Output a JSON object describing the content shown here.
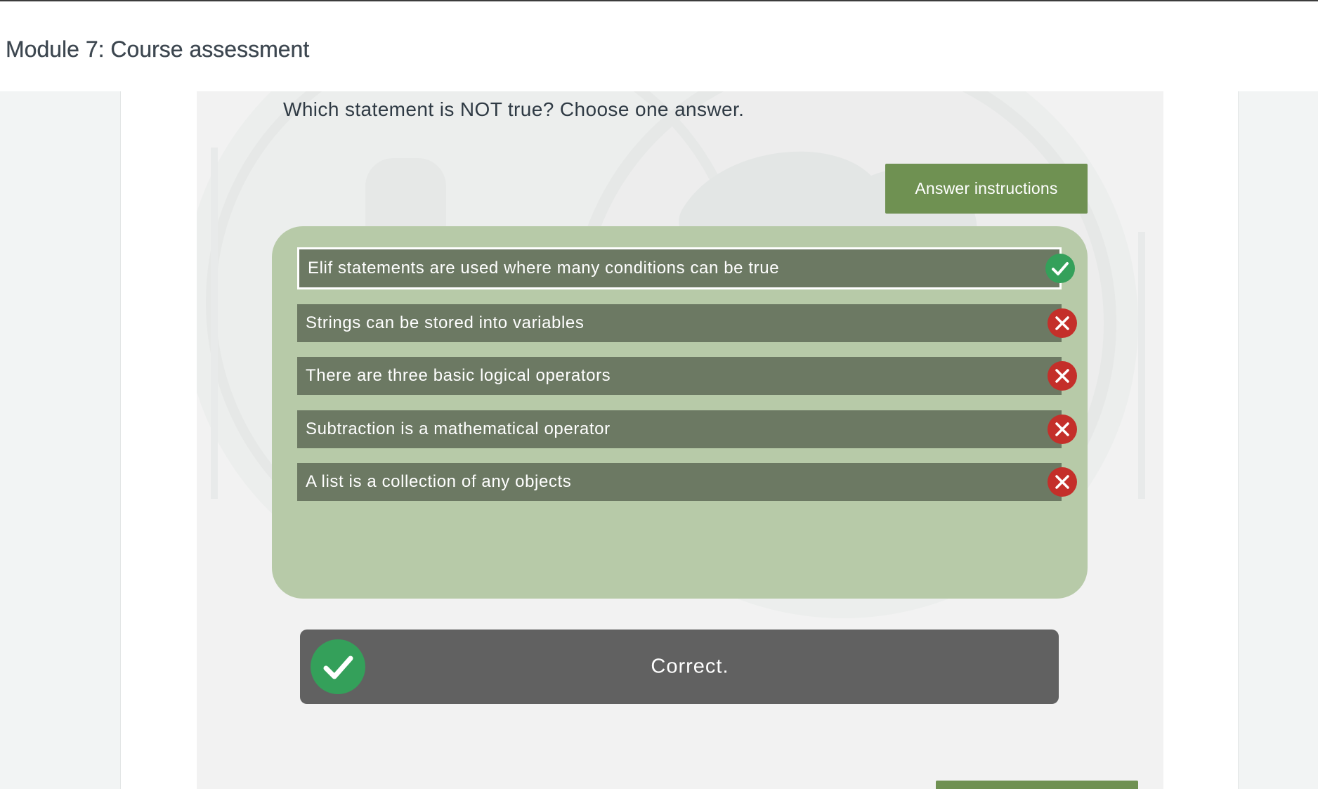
{
  "header": {
    "title": "Module 7: Course assessment"
  },
  "activity": {
    "question": "Which statement is NOT true? Choose one answer.",
    "answer_instructions_label": "Answer instructions",
    "answers": [
      {
        "text": "Elif statements are used where many conditions can be true",
        "selected": true,
        "result": "correct",
        "icon": "check-icon"
      },
      {
        "text": "Strings can be stored into variables",
        "selected": false,
        "result": "incorrect",
        "icon": "close-icon"
      },
      {
        "text": "There are three basic logical operators",
        "selected": false,
        "result": "incorrect",
        "icon": "close-icon"
      },
      {
        "text": "Subtraction is a mathematical operator",
        "selected": false,
        "result": "incorrect",
        "icon": "close-icon"
      },
      {
        "text": "A list is a collection of any objects",
        "selected": false,
        "result": "incorrect",
        "icon": "close-icon"
      }
    ],
    "feedback": {
      "text": "Correct.",
      "icon": "check-icon"
    }
  },
  "colors": {
    "accent_green": "#6f9152",
    "panel_green": "#b7caa8",
    "answer_bg": "#6c7963",
    "correct": "#34a05a",
    "incorrect": "#c42f2a",
    "feedback_bg": "#616161"
  }
}
